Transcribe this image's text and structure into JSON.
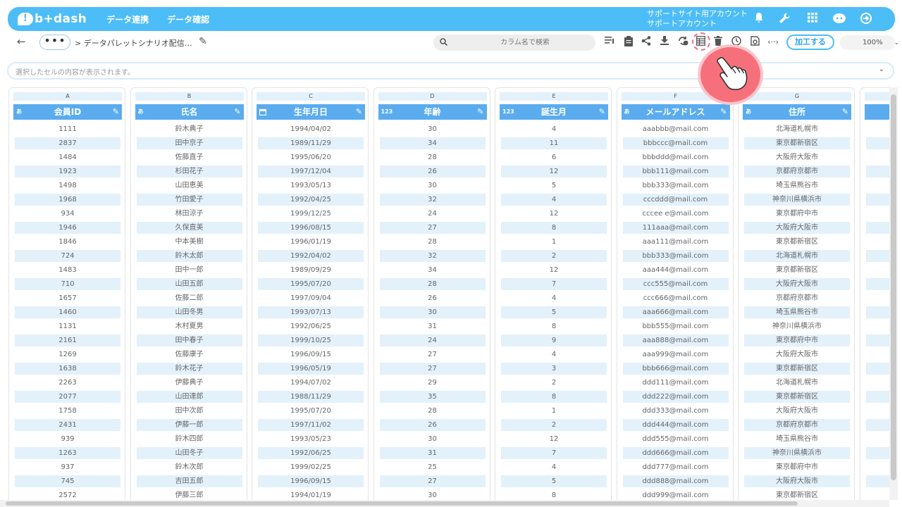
{
  "header": {
    "logo_text": "b+dash",
    "nav": [
      "データ連携",
      "データ確認"
    ],
    "account_line1": "サポートサイト用アカウント",
    "account_line2": "サポートアカウント",
    "icons": [
      "bell-icon",
      "wrench-icon",
      "apps-grid-icon",
      "chat-bot-icon",
      "logout-icon"
    ]
  },
  "toolbar": {
    "back_icon": "←",
    "dots": "•••",
    "breadcrumb": "> データパレットシナリオ配信…",
    "search_placeholder": "カラム名で検索",
    "process_button": "加工する",
    "zoom": "100%",
    "tool_icons": [
      "column-list-icon",
      "clipboard-icon",
      "share-icon",
      "download-icon",
      "sync-icon",
      "table-view-icon",
      "trash-icon",
      "clock-icon",
      "history-icon",
      "code-icon"
    ]
  },
  "content_bar": {
    "placeholder": "選択したセルの内容が表示されます。"
  },
  "grid": {
    "columns": [
      {
        "letter": "A",
        "name": "会員ID",
        "type": "あ"
      },
      {
        "letter": "B",
        "name": "氏名",
        "type": "あ"
      },
      {
        "letter": "C",
        "name": "生年月日",
        "type": "calendar"
      },
      {
        "letter": "D",
        "name": "年齢",
        "type": "123"
      },
      {
        "letter": "E",
        "name": "誕生月",
        "type": "123"
      },
      {
        "letter": "F",
        "name": "メールアドレス",
        "type": "あ"
      },
      {
        "letter": "G",
        "name": "住所",
        "type": "あ"
      }
    ],
    "rows": [
      [
        "1111",
        "鈴木典子",
        "1994/04/02",
        "30",
        "4",
        "aaabbb@mail.com",
        "北海道札幌市"
      ],
      [
        "2837",
        "田中京子",
        "1989/11/29",
        "34",
        "11",
        "bbbccc@mail.com",
        "東京都新宿区"
      ],
      [
        "1484",
        "佐藤直子",
        "1995/06/20",
        "28",
        "6",
        "bbbddd@mail.com",
        "大阪府大阪市"
      ],
      [
        "1923",
        "杉田花子",
        "1997/12/04",
        "26",
        "12",
        "bbb111@mail.com",
        "京都府京都市"
      ],
      [
        "1498",
        "山田恵美",
        "1993/05/13",
        "30",
        "5",
        "bbb333@mail.com",
        "埼玉県熊谷市"
      ],
      [
        "1968",
        "竹田愛子",
        "1992/04/25",
        "32",
        "4",
        "cccddd@mail.com",
        "神奈川県横浜市"
      ],
      [
        "934",
        "林田涼子",
        "1999/12/25",
        "24",
        "12",
        "cccee e@mail.com",
        "東京都府中市"
      ],
      [
        "1946",
        "久保直美",
        "1996/08/15",
        "27",
        "8",
        "111aaa@mail.com",
        "大阪府大阪市"
      ],
      [
        "1846",
        "中本美樹",
        "1996/01/19",
        "28",
        "1",
        "aaa111@mail.com",
        "東京都新宿区"
      ],
      [
        "724",
        "鈴木太郎",
        "1992/04/02",
        "32",
        "2",
        "bbb333@mail.com",
        "北海道札幌市"
      ],
      [
        "1483",
        "田中一郎",
        "1989/09/29",
        "34",
        "12",
        "aaa444@mail.com",
        "東京都新宿区"
      ],
      [
        "710",
        "山田五郎",
        "1995/07/20",
        "28",
        "7",
        "ccc555@mail.com",
        "大阪府大阪市"
      ],
      [
        "1657",
        "佐藤二郎",
        "1997/09/04",
        "26",
        "4",
        "ccc666@mail.com",
        "京都府京都市"
      ],
      [
        "1460",
        "山田冬男",
        "1993/07/13",
        "30",
        "5",
        "aaa666@mail.com",
        "埼玉県熊谷市"
      ],
      [
        "1131",
        "木村夏男",
        "1992/06/25",
        "31",
        "8",
        "bbb555@mail.com",
        "神奈川県横浜市"
      ],
      [
        "2161",
        "田中春子",
        "1999/10/25",
        "24",
        "9",
        "aaa888@mail.com",
        "東京都府中市"
      ],
      [
        "1269",
        "佐藤康子",
        "1996/09/15",
        "27",
        "4",
        "aaa999@mail.com",
        "大阪府大阪市"
      ],
      [
        "1638",
        "鈴木花子",
        "1996/05/19",
        "27",
        "3",
        "bbb666@mail.com",
        "東京都新宿区"
      ],
      [
        "2263",
        "伊藤典子",
        "1994/07/02",
        "29",
        "2",
        "ddd111@mail.com",
        "北海道札幌市"
      ],
      [
        "2077",
        "山田達郎",
        "1988/11/29",
        "35",
        "8",
        "ddd222@mail.com",
        "東京都新宿区"
      ],
      [
        "1758",
        "田中次郎",
        "1995/07/20",
        "28",
        "1",
        "ddd333@mail.com",
        "大阪府大阪市"
      ],
      [
        "2431",
        "伊藤一郎",
        "1997/11/02",
        "26",
        "2",
        "ddd444@mail.com",
        "京都府京都市"
      ],
      [
        "939",
        "鈴木四郎",
        "1993/05/23",
        "30",
        "12",
        "ddd555@mail.com",
        "埼玉県熊谷市"
      ],
      [
        "1263",
        "山田冬子",
        "1992/06/25",
        "31",
        "7",
        "ddd666@mail.com",
        "神奈川県横浜市"
      ],
      [
        "937",
        "鈴木次郎",
        "1999/02/25",
        "25",
        "4",
        "ddd777@mail.com",
        "東京都府中市"
      ],
      [
        "745",
        "吉田五郎",
        "1996/09/15",
        "27",
        "5",
        "ddd888@mail.com",
        "大阪府大阪市"
      ],
      [
        "2572",
        "伊藤三郎",
        "1994/01/19",
        "30",
        "8",
        "ddd999@mail.com",
        "東京都新宿区"
      ]
    ]
  },
  "colors": {
    "primary": "#4cbdf7",
    "header_cell": "#5aacef",
    "alt_row": "#e3f1fb",
    "pointer": "#f6707b"
  }
}
